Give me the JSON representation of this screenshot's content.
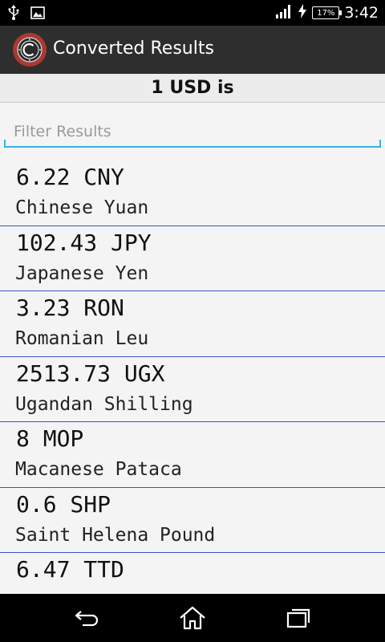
{
  "status_bar": {
    "battery": "17%",
    "time": "3:42"
  },
  "action_bar": {
    "title": "Converted Results"
  },
  "header": {
    "text": "1 USD is"
  },
  "filter": {
    "placeholder": "Filter Results"
  },
  "results": [
    {
      "amount": "6.22 CNY",
      "name": "Chinese Yuan"
    },
    {
      "amount": "102.43 JPY",
      "name": "Japanese Yen"
    },
    {
      "amount": "3.23 RON",
      "name": "Romanian Leu"
    },
    {
      "amount": "2513.73 UGX",
      "name": "Ugandan Shilling"
    },
    {
      "amount": "8 MOP",
      "name": "Macanese Pataca"
    },
    {
      "amount": "0.6 SHP",
      "name": "Saint Helena Pound"
    },
    {
      "amount": "6.47 TTD",
      "name": ""
    }
  ],
  "colors": {
    "accent": "#33b5e5",
    "divider": "#3a54c8",
    "app_icon": "#a83a32"
  }
}
